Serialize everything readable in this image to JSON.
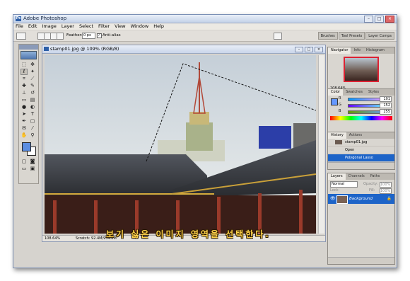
{
  "app": {
    "title": "Adobe Photoshop"
  },
  "menu": [
    "File",
    "Edit",
    "Image",
    "Layer",
    "Select",
    "Filter",
    "View",
    "Window",
    "Help"
  ],
  "options": {
    "feather_label": "Feather:",
    "feather_value": "0 px",
    "antialias_label": "Anti-alias"
  },
  "wells": [
    "Brushes",
    "Tool Presets",
    "Layer Comps"
  ],
  "document": {
    "title": "stamp01.jpg @ 109% (RGB/8)",
    "zoom": "108.64%",
    "scratch": "Scratch: 92.4M/934.8M"
  },
  "navigator": {
    "tabs": [
      "Navigator",
      "Info",
      "Histogram"
    ],
    "zoom": "108.64%"
  },
  "color": {
    "tabs": [
      "Color",
      "Swatches",
      "Styles"
    ],
    "r_label": "R",
    "g_label": "G",
    "b_label": "B",
    "r": "101",
    "g": "152",
    "b": "255"
  },
  "history": {
    "tabs": [
      "History",
      "Actions"
    ],
    "snapshot": "stamp01.jpg",
    "items": [
      "Open",
      "Polygonal Lasso"
    ]
  },
  "layers": {
    "tabs": [
      "Layers",
      "Channels",
      "Paths"
    ],
    "blend": "Normal",
    "opacity_label": "Opacity:",
    "opacity": "100%",
    "lock_label": "Lock:",
    "fill_label": "Fill:",
    "fill": "100%",
    "layer_name": "Background"
  },
  "caption": "보기 싫은 이미지 영역을 선택한다."
}
